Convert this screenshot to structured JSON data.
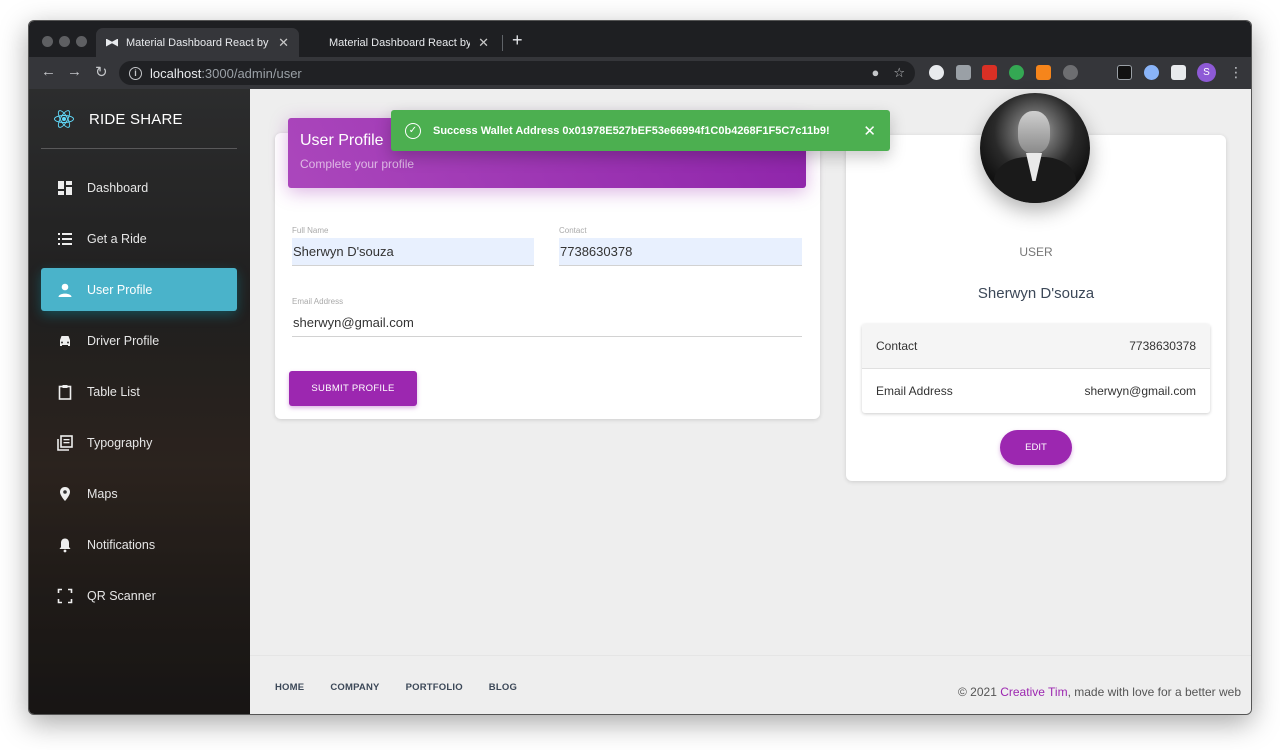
{
  "browser": {
    "tabs": [
      {
        "title": "Material Dashboard React by Creative Tim",
        "active": true
      },
      {
        "title": "Material Dashboard React by Creative Tim",
        "active": false
      }
    ],
    "url_host": "localhost",
    "url_path": ":3000/admin/user",
    "profile_initial": "S",
    "new_tab": "+",
    "close_glyph": "✕"
  },
  "sidebar": {
    "brand": "RIDE SHARE",
    "items": [
      {
        "label": "Dashboard",
        "icon": "dashboard-icon"
      },
      {
        "label": "Get a Ride",
        "icon": "list-icon"
      },
      {
        "label": "User Profile",
        "icon": "person-icon",
        "active": true
      },
      {
        "label": "Driver Profile",
        "icon": "car-icon"
      },
      {
        "label": "Table List",
        "icon": "clipboard-icon"
      },
      {
        "label": "Typography",
        "icon": "library-books-icon"
      },
      {
        "label": "Maps",
        "icon": "location-pin-icon"
      },
      {
        "label": "Notifications",
        "icon": "bell-icon"
      },
      {
        "label": "QR Scanner",
        "icon": "scan-frame-icon"
      }
    ],
    "active_color": "#4ab3ca"
  },
  "profile_form": {
    "title": "User Profile",
    "subtitle": "Complete your profile",
    "full_name_label": "Full Name",
    "full_name_value": "Sherwyn D'souza",
    "contact_label": "Contact",
    "contact_value": "7738630378",
    "email_label": "Email Address",
    "email_value": "sherwyn@gmail.com",
    "submit_label": "SUBMIT PROFILE"
  },
  "notification": {
    "text": "Success Wallet Address 0x01978E527bEF53e66994f1C0b4268F1F5C7c11b9!",
    "color": "#4caf50"
  },
  "user_card": {
    "role": "USER",
    "name": "Sherwyn D'souza",
    "rows": [
      {
        "label": "Contact",
        "value": "7738630378"
      },
      {
        "label": "Email Address",
        "value": "sherwyn@gmail.com"
      }
    ],
    "edit_label": "EDIT"
  },
  "footer": {
    "links": [
      "HOME",
      "COMPANY",
      "PORTFOLIO",
      "BLOG"
    ],
    "copyright_prefix": "© 2021 ",
    "copyright_brand": "Creative Tim",
    "copyright_suffix": ", made with love for a better web"
  },
  "colors": {
    "primary": "#9c27b0",
    "accent": "#4ab3ca",
    "success": "#4caf50"
  }
}
